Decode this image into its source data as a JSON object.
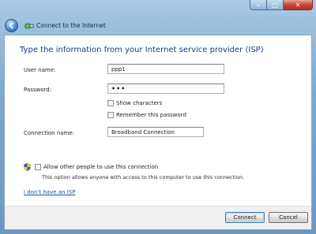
{
  "window": {
    "background_title": "",
    "nav_title": "Connect to the Internet",
    "controls": {
      "minimize": "–",
      "maximize": "□",
      "close": "✕"
    }
  },
  "heading": "Type the information from your Internet service provider (ISP)",
  "form": {
    "username": {
      "label": "User name:",
      "value": "ppp1"
    },
    "password": {
      "label": "Password:",
      "value": "•••"
    },
    "show_characters": {
      "label": "Show characters",
      "checked": false
    },
    "remember_password": {
      "label": "Remember this password",
      "checked": false
    },
    "connection_name": {
      "label": "Connection name:",
      "value": "Broadband Connection"
    }
  },
  "sharing": {
    "allow_label": "Allow other people to use this connection",
    "allow_checked": false,
    "note": "This option allows anyone with access to this computer to use this connection."
  },
  "link": "I don't have an ISP",
  "buttons": {
    "connect": "Connect",
    "cancel": "Cancel"
  },
  "colors": {
    "heading": "#1a3a8a",
    "link": "#1a52b0",
    "frame": "#7fa8cc"
  },
  "icons": {
    "back": "back-arrow-icon",
    "network": "network-icon",
    "shield": "uac-shield-icon"
  }
}
